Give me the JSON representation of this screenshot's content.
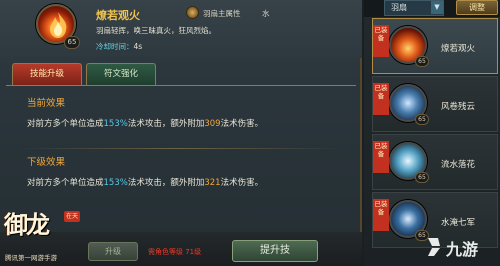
{
  "skill": {
    "name": "燎若观火",
    "level": "65",
    "attr_label": "羽扇主属性",
    "attr_value": "水",
    "description": "羽扇轻挥，唤三昧真火，狂风烈焰。",
    "cooldown_label": "冷却时间：",
    "cooldown_value": "4s"
  },
  "tabs": {
    "upgrade": "技能升级",
    "rune": "符文强化"
  },
  "current": {
    "title": "当前效果",
    "part1": "对前方多个单位造成",
    "percent": "153%",
    "part2": "法术攻击，额外附加",
    "bonus": "309",
    "part3": "法术伤害。"
  },
  "next": {
    "title": "下级效果",
    "part1": "对前方多个单位造成",
    "percent": "153%",
    "part2": "法术攻击，额外附加",
    "bonus": "321",
    "part3": "法术伤害。"
  },
  "footer": {
    "logo": "御龙",
    "logo_tag": "在天",
    "logo_sub": "腾讯第一网游手游",
    "upgrade_small": "升级",
    "level_req": "需角色等级 71级",
    "upgrade_big": "提升技"
  },
  "sidebar": {
    "filter": "羽扇",
    "arrow": "▼",
    "adjust": "调整",
    "items": [
      {
        "name": "燎若观火",
        "level": "65",
        "equipped": "已装备",
        "icon": "fire-icon",
        "color": "#e05a1a"
      },
      {
        "name": "风卷残云",
        "level": "65",
        "equipped": "已装备",
        "icon": "whirlwind-icon",
        "color": "#4a7fb0"
      },
      {
        "name": "流水落花",
        "level": "65",
        "equipped": "已装备",
        "icon": "water-icon",
        "color": "#5aa6c8"
      },
      {
        "name": "水淹七军",
        "level": "65",
        "equipped": "已装备",
        "icon": "wave-icon",
        "color": "#3a6ea0"
      }
    ]
  },
  "watermark": {
    "text": "九游",
    "icon": "nine-game-logo-icon"
  }
}
